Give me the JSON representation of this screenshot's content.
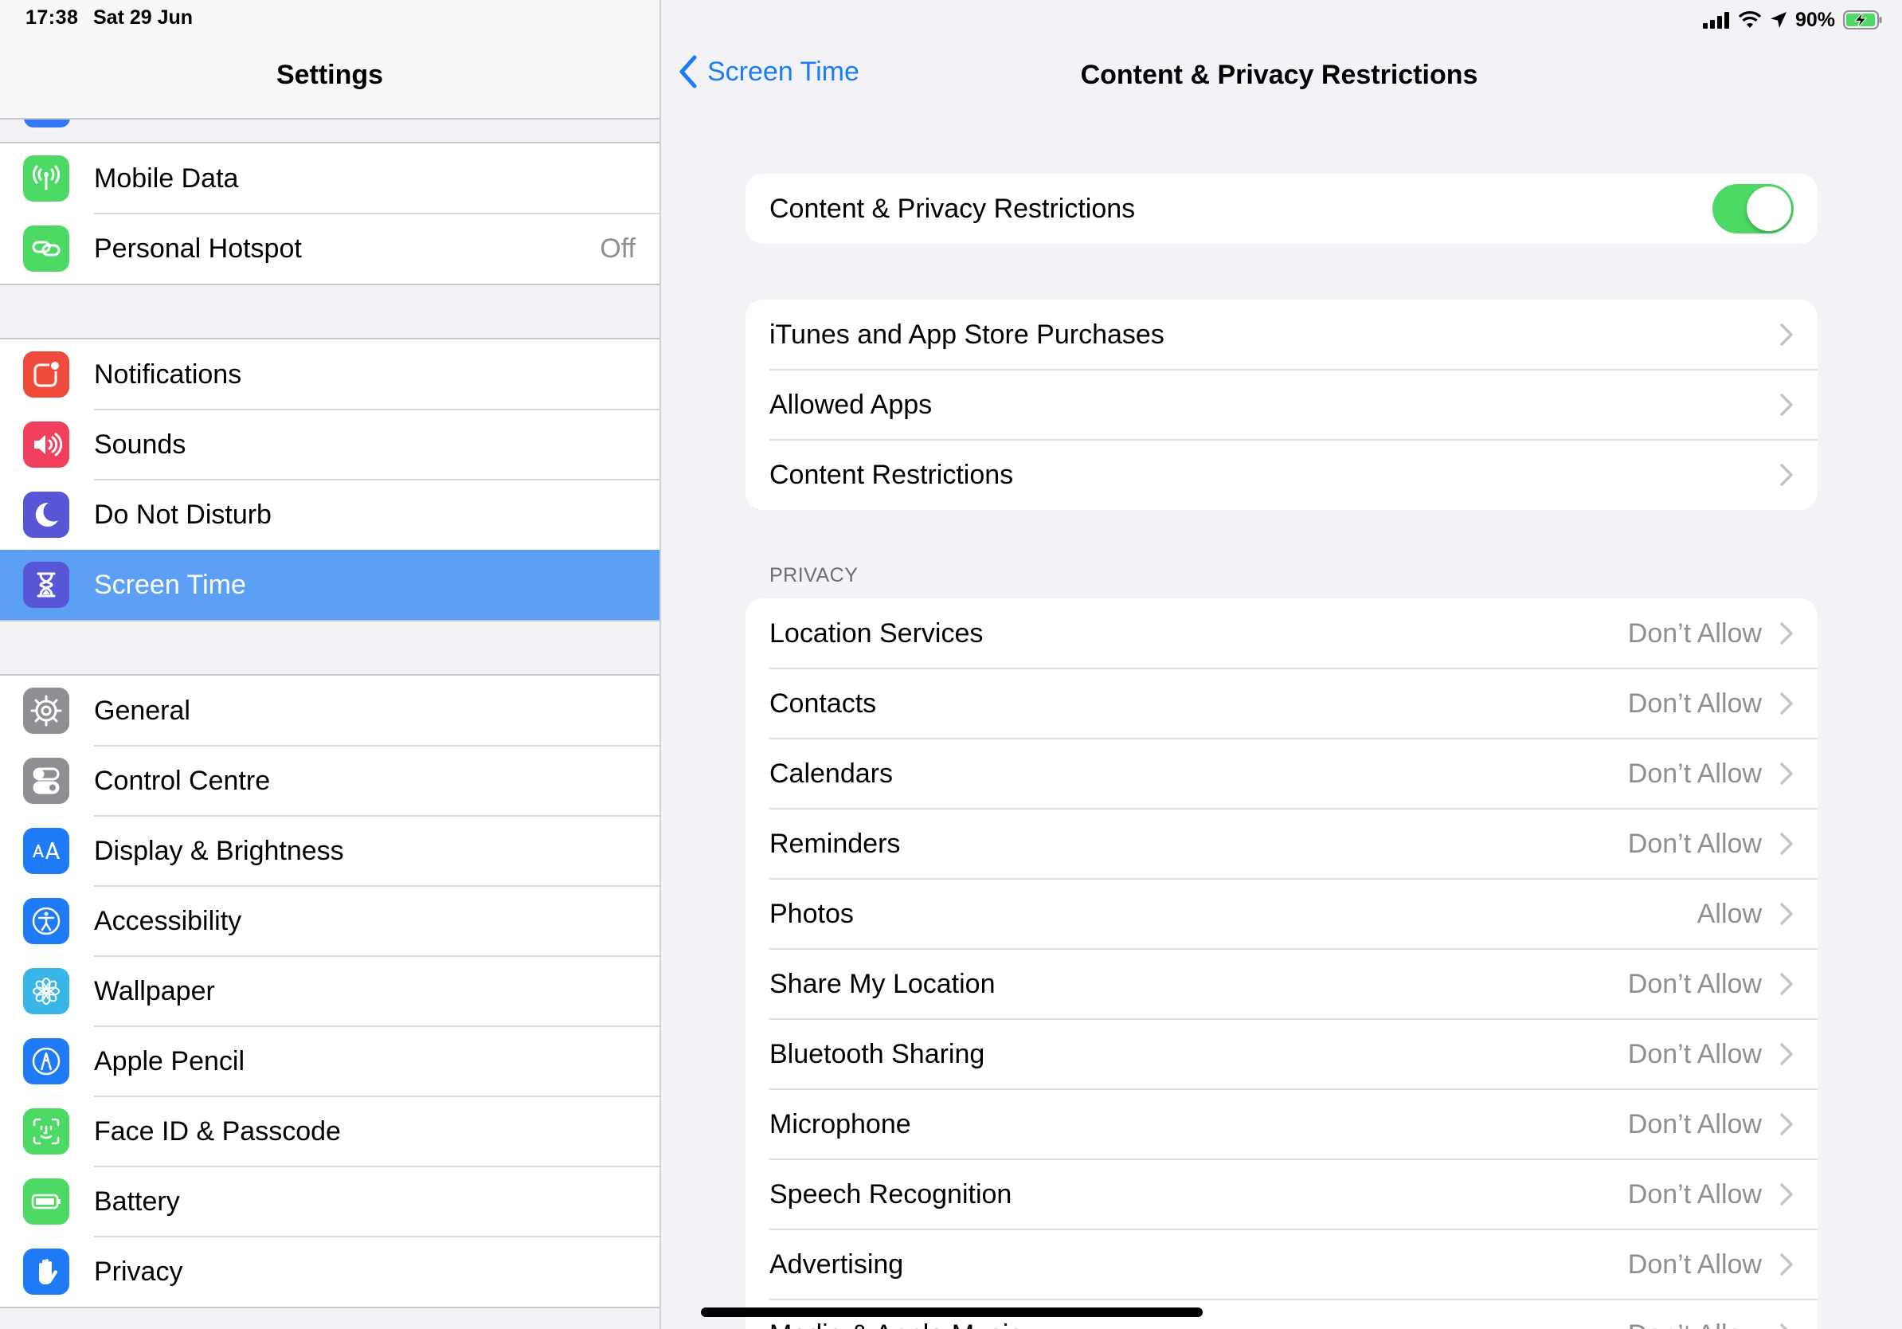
{
  "status": {
    "time": "17:38",
    "date": "Sat 29 Jun",
    "battery": "90%"
  },
  "sidebar": {
    "title": "Settings",
    "groups": [
      {
        "items": [
          {
            "label": "Mobile Data",
            "icon": "antenna-icon",
            "color": "#4cd964"
          },
          {
            "label": "Personal Hotspot",
            "value": "Off",
            "icon": "hotspot-icon",
            "color": "#4cd964"
          }
        ]
      },
      {
        "items": [
          {
            "label": "Notifications",
            "icon": "notifications-icon",
            "color": "#f04a3c"
          },
          {
            "label": "Sounds",
            "icon": "speaker-icon",
            "color": "#f0405e"
          },
          {
            "label": "Do Not Disturb",
            "icon": "moon-icon",
            "color": "#5856d6"
          },
          {
            "label": "Screen Time",
            "icon": "hourglass-icon",
            "color": "#5856d6",
            "selected": true
          }
        ]
      },
      {
        "items": [
          {
            "label": "General",
            "icon": "gear-icon",
            "color": "#8e8e93"
          },
          {
            "label": "Control Centre",
            "icon": "switches-icon",
            "color": "#8e8e93"
          },
          {
            "label": "Display & Brightness",
            "icon": "text-size-icon",
            "color": "#1f7af5"
          },
          {
            "label": "Accessibility",
            "icon": "accessibility-icon",
            "color": "#1f7af5"
          },
          {
            "label": "Wallpaper",
            "icon": "flower-icon",
            "color": "#39b6e8"
          },
          {
            "label": "Apple Pencil",
            "icon": "pencil-icon",
            "color": "#1f7af5"
          },
          {
            "label": "Face ID & Passcode",
            "icon": "face-id-icon",
            "color": "#4cd964"
          },
          {
            "label": "Battery",
            "icon": "battery-icon",
            "color": "#4cd964"
          },
          {
            "label": "Privacy",
            "icon": "hand-icon",
            "color": "#1f7af5"
          }
        ]
      }
    ]
  },
  "detail": {
    "back_label": "Screen Time",
    "title": "Content & Privacy Restrictions",
    "toggle_row": {
      "label": "Content & Privacy Restrictions",
      "on": true
    },
    "store_rows": [
      {
        "label": "iTunes and App Store Purchases"
      },
      {
        "label": "Allowed Apps"
      },
      {
        "label": "Content Restrictions"
      }
    ],
    "privacy_header": "PRIVACY",
    "privacy_rows": [
      {
        "label": "Location Services",
        "value": "Don’t Allow"
      },
      {
        "label": "Contacts",
        "value": "Don’t Allow"
      },
      {
        "label": "Calendars",
        "value": "Don’t Allow"
      },
      {
        "label": "Reminders",
        "value": "Don’t Allow"
      },
      {
        "label": "Photos",
        "value": "Allow"
      },
      {
        "label": "Share My Location",
        "value": "Don’t Allow"
      },
      {
        "label": "Bluetooth Sharing",
        "value": "Don’t Allow"
      },
      {
        "label": "Microphone",
        "value": "Don’t Allow"
      },
      {
        "label": "Speech Recognition",
        "value": "Don’t Allow"
      },
      {
        "label": "Advertising",
        "value": "Don’t Allow"
      },
      {
        "label": "Media & Apple Music",
        "value": "Don’t Allow"
      }
    ]
  }
}
